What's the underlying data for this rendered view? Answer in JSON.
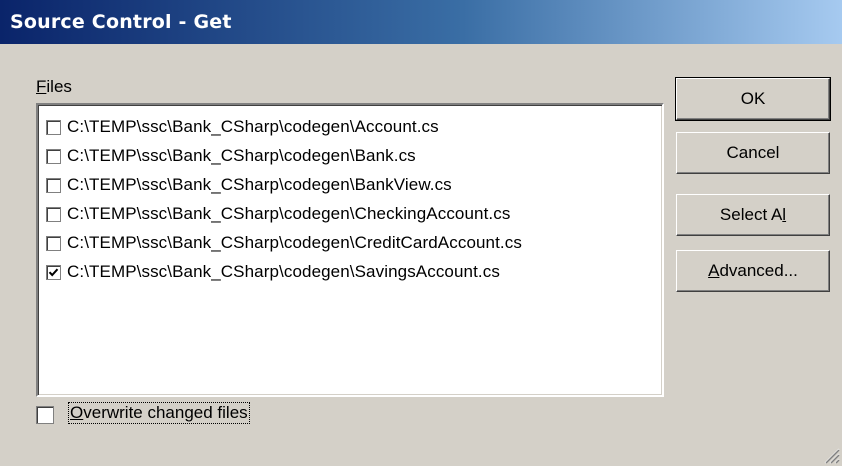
{
  "window": {
    "title": "Source Control - Get"
  },
  "files": {
    "label_prefix": "",
    "label_mnemonic": "F",
    "label_rest": "iles",
    "items": [
      {
        "path": "C:\\TEMP\\ssc\\Bank_CSharp\\codegen\\Account.cs",
        "checked": false
      },
      {
        "path": "C:\\TEMP\\ssc\\Bank_CSharp\\codegen\\Bank.cs",
        "checked": false
      },
      {
        "path": "C:\\TEMP\\ssc\\Bank_CSharp\\codegen\\BankView.cs",
        "checked": false
      },
      {
        "path": "C:\\TEMP\\ssc\\Bank_CSharp\\codegen\\CheckingAccount.cs",
        "checked": false
      },
      {
        "path": "C:\\TEMP\\ssc\\Bank_CSharp\\codegen\\CreditCardAccount.cs",
        "checked": false
      },
      {
        "path": "C:\\TEMP\\ssc\\Bank_CSharp\\codegen\\SavingsAccount.cs",
        "checked": true
      }
    ]
  },
  "buttons": {
    "ok": "OK",
    "cancel": "Cancel",
    "select_all_prefix": "Select A",
    "select_all_mnemonic": "l",
    "select_all_rest": "l",
    "advanced_mnemonic": "A",
    "advanced_rest": "dvanced..."
  },
  "overwrite": {
    "mnemonic": "O",
    "rest": "verwrite changed files",
    "checked": false
  },
  "colors": {
    "titlebar_start": "#0a246a",
    "titlebar_end": "#a6caf0",
    "dialog_bg": "#d4d0c8"
  }
}
